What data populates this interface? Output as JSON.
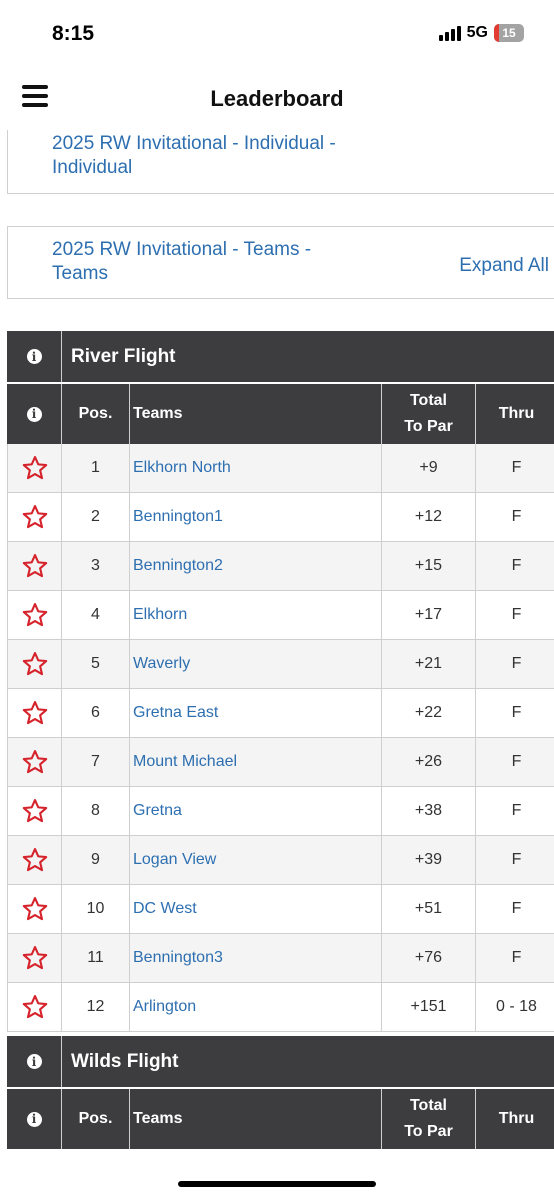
{
  "status_bar": {
    "time": "8:15",
    "network": "5G",
    "battery": "15"
  },
  "header": {
    "title": "Leaderboard"
  },
  "events": [
    {
      "title_line1": "2025 RW Invitational - Individual -",
      "title_line2": "Individual"
    },
    {
      "title_line1": "2025 RW Invitational - Teams -",
      "title_line2": "Teams",
      "action": "Expand All"
    }
  ],
  "columns": {
    "pos": "Pos.",
    "teams": "Teams",
    "total_line1": "Total",
    "total_line2": "To Par",
    "thru": "Thru"
  },
  "flights": [
    {
      "name": "River Flight",
      "rows": [
        {
          "pos": "1",
          "team": "Elkhorn North",
          "to_par": "+9",
          "thru": "F"
        },
        {
          "pos": "2",
          "team": "Bennington1",
          "to_par": "+12",
          "thru": "F"
        },
        {
          "pos": "3",
          "team": "Bennington2",
          "to_par": "+15",
          "thru": "F"
        },
        {
          "pos": "4",
          "team": "Elkhorn",
          "to_par": "+17",
          "thru": "F"
        },
        {
          "pos": "5",
          "team": "Waverly",
          "to_par": "+21",
          "thru": "F"
        },
        {
          "pos": "6",
          "team": "Gretna East",
          "to_par": "+22",
          "thru": "F"
        },
        {
          "pos": "7",
          "team": "Mount Michael",
          "to_par": "+26",
          "thru": "F"
        },
        {
          "pos": "8",
          "team": "Gretna",
          "to_par": "+38",
          "thru": "F"
        },
        {
          "pos": "9",
          "team": "Logan View",
          "to_par": "+39",
          "thru": "F"
        },
        {
          "pos": "10",
          "team": "DC West",
          "to_par": "+51",
          "thru": "F"
        },
        {
          "pos": "11",
          "team": "Bennington3",
          "to_par": "+76",
          "thru": "F"
        },
        {
          "pos": "12",
          "team": "Arlington",
          "to_par": "+151",
          "thru": "0 - 18"
        }
      ]
    },
    {
      "name": "Wilds Flight",
      "rows": []
    }
  ],
  "colors": {
    "header_bg": "#3d3c3e",
    "link": "#2d6fb0",
    "star": "#d6222a"
  }
}
